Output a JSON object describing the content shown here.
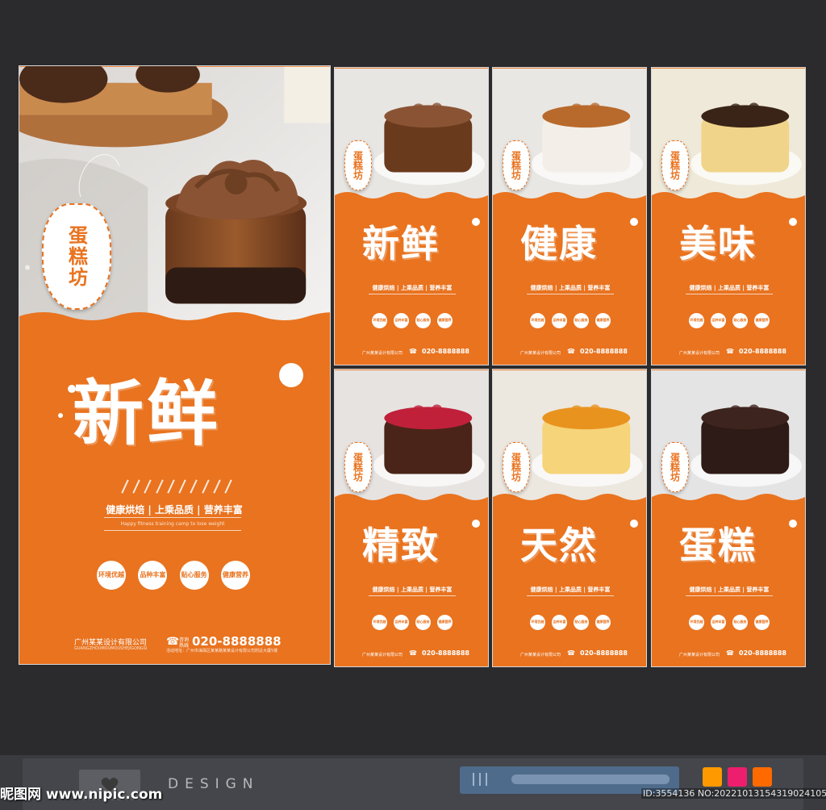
{
  "colors": {
    "orange": "#e9731f",
    "background": "#2b2b2d",
    "white": "#ffffff"
  },
  "main_poster": {
    "tag": "蛋糕坊",
    "title": "新鲜",
    "features": "健康烘焙 | 上乘品质 | 营养丰富",
    "subtitle": "Happy fitness training camp to lose weight",
    "circles": [
      "环境优越",
      "品种丰富",
      "贴心服务",
      "健康营养"
    ],
    "company": "广州某某设计有限公司",
    "company_en": "GUANGZHOUMOUMOUSHEJIGONGSI",
    "phone_label": "咨询热线",
    "phone": "020-8888888",
    "address": "活动地址：广州市海珠区某某路某某设计有限公司附近大厦5楼"
  },
  "small_posters": [
    {
      "title": "新鲜",
      "tag": "蛋糕坊",
      "features": "健康烘焙 | 上乘品质 | 营养丰富",
      "circles": [
        "环境优越",
        "品种丰富",
        "贴心服务",
        "健康营养"
      ],
      "company": "广州某某设计有限公司",
      "phone": "020-8888888"
    },
    {
      "title": "健康",
      "tag": "蛋糕坊",
      "features": "健康烘焙 | 上乘品质 | 营养丰富",
      "circles": [
        "环境优越",
        "品种丰富",
        "贴心服务",
        "健康营养"
      ],
      "company": "广州某某设计有限公司",
      "phone": "020-8888888"
    },
    {
      "title": "美味",
      "tag": "蛋糕坊",
      "features": "健康烘焙 | 上乘品质 | 营养丰富",
      "circles": [
        "环境优越",
        "品种丰富",
        "贴心服务",
        "健康营养"
      ],
      "company": "广州某某设计有限公司",
      "phone": "020-8888888"
    },
    {
      "title": "精致",
      "tag": "蛋糕坊",
      "features": "健康烘焙 | 上乘品质 | 营养丰富",
      "circles": [
        "环境优越",
        "品种丰富",
        "贴心服务",
        "健康营养"
      ],
      "company": "广州某某设计有限公司",
      "phone": "020-8888888"
    },
    {
      "title": "天然",
      "tag": "蛋糕坊",
      "features": "健康烘焙 | 上乘品质 | 营养丰富",
      "circles": [
        "环境优越",
        "品种丰富",
        "贴心服务",
        "健康营养"
      ],
      "company": "广州某某设计有限公司",
      "phone": "020-8888888"
    },
    {
      "title": "蛋糕",
      "tag": "蛋糕坊",
      "features": "健康烘焙 | 上乘品质 | 营养丰富",
      "circles": [
        "环境优越",
        "品种丰富",
        "贴心服务",
        "健康营养"
      ],
      "company": "广州某某设计有限公司",
      "phone": "020-8888888"
    }
  ],
  "bottom_bar": {
    "design_word": "DESIGN",
    "watermark": "昵图网 www.nipic.com",
    "id_text": "ID:3554136 NO:20221013154319024105",
    "swatches": [
      "#ff9900",
      "#ee1e6e",
      "#ff6a00"
    ]
  }
}
